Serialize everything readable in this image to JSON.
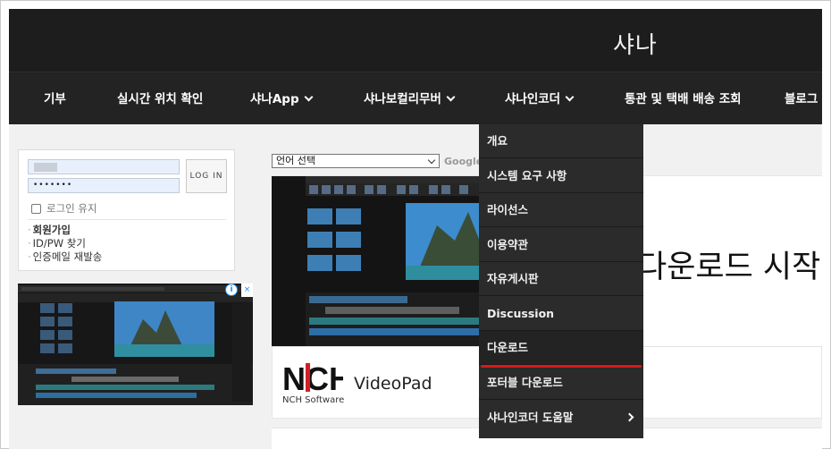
{
  "header": {
    "site_title": "샤나"
  },
  "nav": {
    "items": [
      {
        "label": "기부",
        "has_menu": false
      },
      {
        "label": "실시간 위치 확인",
        "has_menu": false
      },
      {
        "label": "샤나App",
        "has_menu": true
      },
      {
        "label": "샤나보컬리무버",
        "has_menu": true
      },
      {
        "label": "샤나인코더",
        "has_menu": true
      },
      {
        "label": "통관 및 택배 배송 조회",
        "has_menu": false
      },
      {
        "label": "블로그",
        "has_menu": false
      }
    ]
  },
  "dropdown": {
    "items": [
      {
        "label": "개요"
      },
      {
        "label": "시스템 요구 사항"
      },
      {
        "label": "라이선스"
      },
      {
        "label": "이용약관"
      },
      {
        "label": "자유게시판"
      },
      {
        "label": "Discussion"
      },
      {
        "label": "다운로드",
        "highlighted": true
      },
      {
        "label": "포터블 다운로드"
      },
      {
        "label": "샤나인코더 도움말",
        "submenu": true
      }
    ],
    "highlight_color": "#d71a1a"
  },
  "login": {
    "password_mask": "•••••••",
    "login_button": "LOG IN",
    "keep_login": "로그인 유지",
    "links": [
      "회원가입",
      "ID/PW 찾기",
      "인증메일 재발송"
    ]
  },
  "main": {
    "language_select": "언어 선택",
    "google_label": "Google",
    "ad": {
      "headline": "다운로드 시작",
      "brand_logo": "NCH",
      "brand_company": "NCH Software",
      "product": "VideoPad"
    }
  },
  "side_ad": {
    "info_icon": "i",
    "close_icon": "×"
  },
  "colors": {
    "header_bg": "#1d1d1d",
    "nav_bg": "#232323",
    "dropdown_bg": "#2b2b2b",
    "content_bg": "#f1f1f1",
    "accent": "#d71a1a"
  }
}
